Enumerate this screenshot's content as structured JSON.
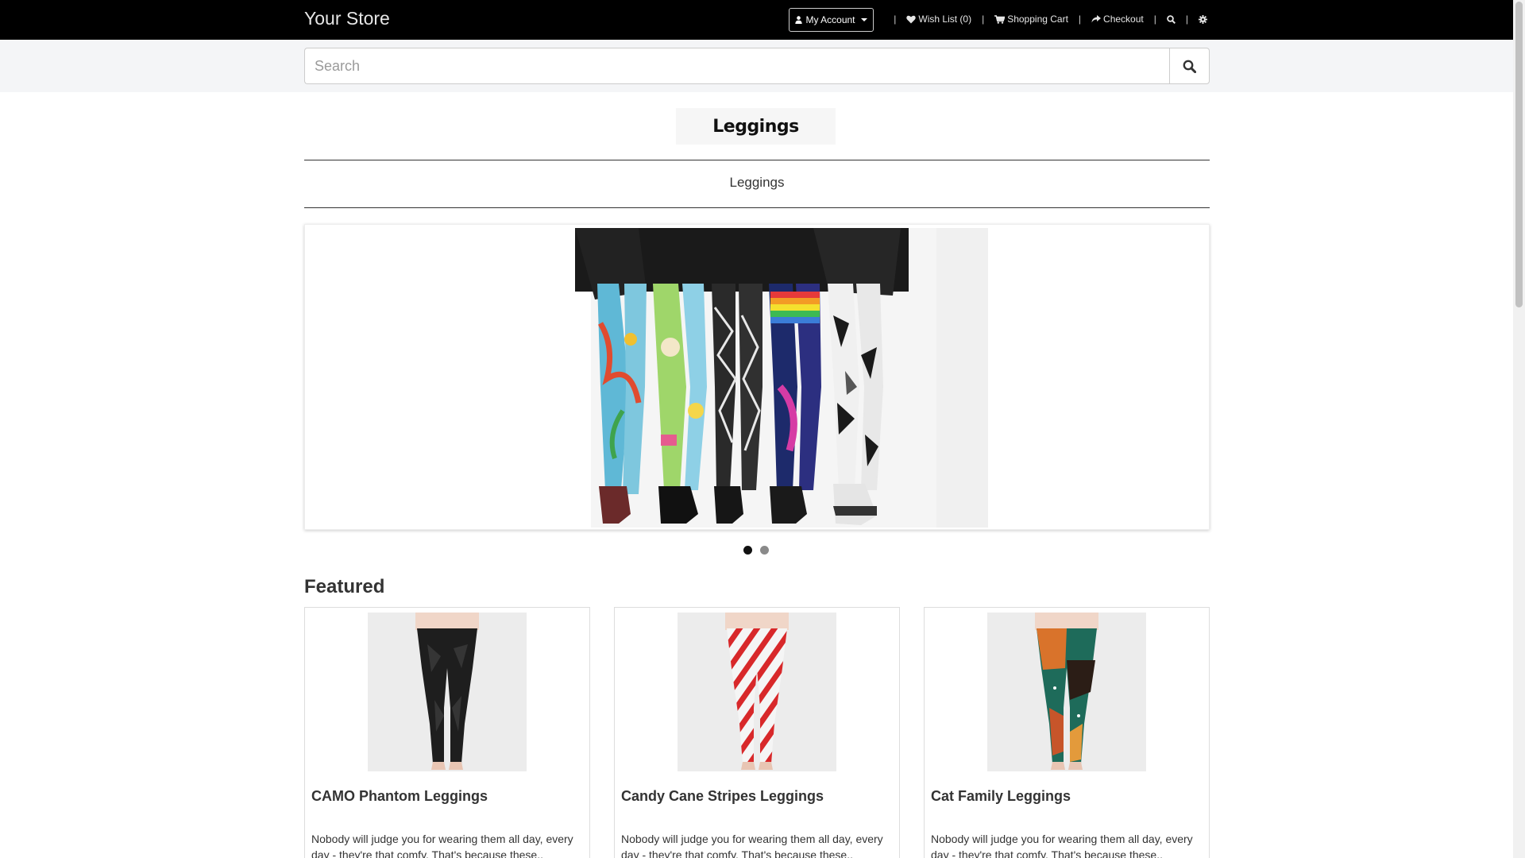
{
  "header": {
    "brand": "Your Store",
    "account_label": "My Account",
    "wishlist_label": "Wish List (0)",
    "cart_label": "Shopping Cart",
    "checkout_label": "Checkout",
    "separator": "|"
  },
  "search": {
    "placeholder": "Search",
    "value": ""
  },
  "category": {
    "logo_text": "Leggings",
    "title": "Leggings"
  },
  "slideshow": {
    "slides": 2,
    "active_index": 0
  },
  "featured": {
    "heading": "Featured",
    "products": [
      {
        "name": "CAMO Phantom Leggings",
        "description": "Nobody will judge you for wearing them all day, every day - they're that comfy. That's because these.."
      },
      {
        "name": "Candy Cane Stripes Leggings",
        "description": "Nobody will judge you for wearing them all day, every day - they're that comfy. That's because these.."
      },
      {
        "name": "Cat Family Leggings",
        "description": "Nobody will judge you for wearing them all day, every day - they're that comfy. That's because these.."
      }
    ]
  },
  "icons": {
    "account": "user-icon",
    "wishlist": "heart-icon",
    "cart": "cart-icon",
    "checkout": "share-icon",
    "search": "search-icon",
    "settings": "gear-icon"
  },
  "colors": {
    "topbar": "#000000",
    "search_band": "#f4f5f7",
    "text": "#333333"
  }
}
